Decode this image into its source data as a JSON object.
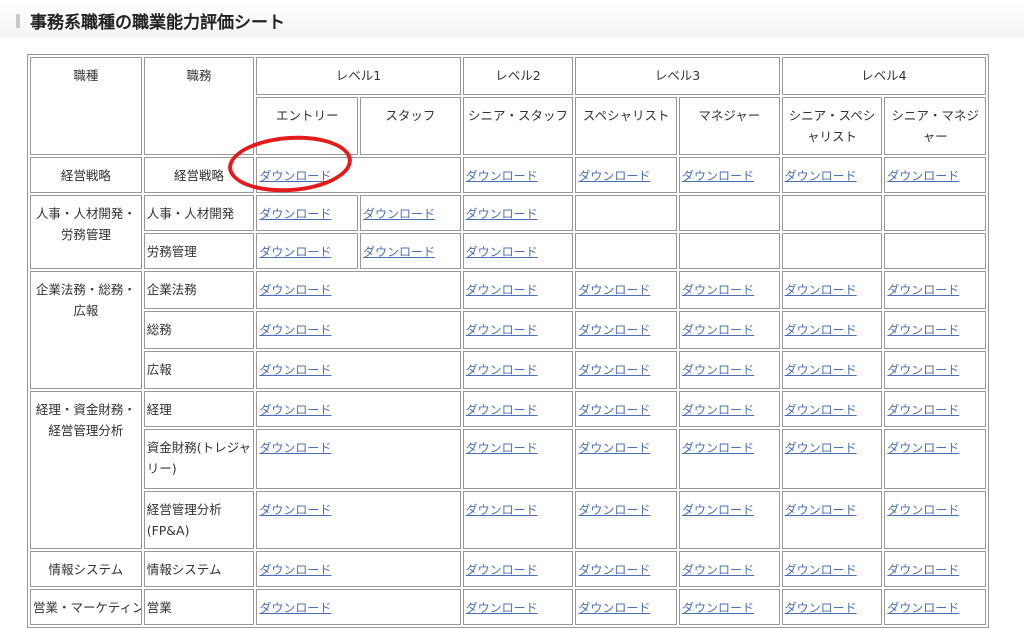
{
  "page": {
    "title": "事務系職種の職業能力評価シート"
  },
  "table": {
    "h_job": "職種",
    "h_duty": "職務",
    "levels": [
      "レベル1",
      "レベル2",
      "レベル3",
      "レベル4"
    ],
    "sub": [
      "エントリー",
      "スタッフ",
      "シニア・スタッフ",
      "スペシャリスト",
      "マネジャー",
      "シニア・スペシャリスト",
      "シニア・マネジャー"
    ],
    "link": "ダウンロード",
    "jobs": {
      "keiei": "経営戦略",
      "jinji": "人事・人材開発・労務管理",
      "kigyo": "企業法務・総務・広報",
      "keiri": "経理・資金財務・経営管理分析",
      "joho": "情報システム",
      "eigyo": "営業・マーケティン"
    },
    "duties": {
      "keiei": "経営戦略",
      "jinji_kaihatsu": "人事・人材開発",
      "romu": "労務管理",
      "homu": "企業法務",
      "somu": "総務",
      "koho": "広報",
      "keiri": "経理",
      "shikin": "資金財務(トレジャリー)",
      "bunseki": "経営管理分析(FP&A)",
      "joho": "情報システム",
      "eigyo": "営業"
    }
  },
  "annotation": {
    "circle_color": "#e51b1b"
  },
  "colors": {
    "link": "#4c6fb8",
    "border": "#999999"
  }
}
